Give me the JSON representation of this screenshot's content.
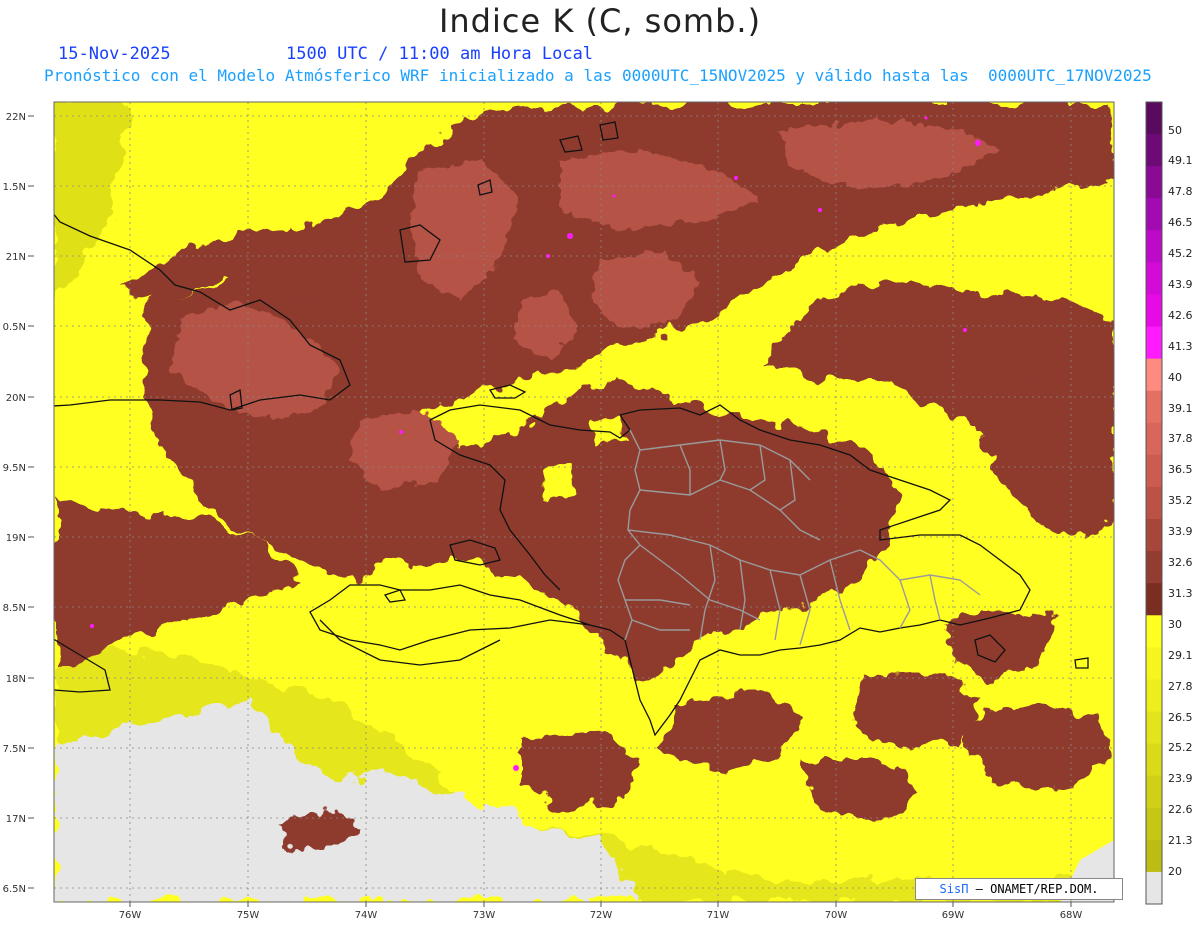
{
  "title": "Indice K (C, somb.)",
  "date_text": "15-Nov-2025",
  "time_text": "1500 UTC / 11:00 am Hora Local",
  "forecast_text": "Pronóstico con el Modelo Atmósferico WRF inicializado a las 0000UTC_15NOV2025 y válido hasta las  0000UTC_17NOV2025",
  "credit": {
    "logo_text": "SisΠ",
    "text": "– ONAMET/REP.DOM."
  },
  "lat_labels": [
    "22N",
    "1.5N",
    "21N",
    "0.5N",
    "20N",
    "9.5N",
    "19N",
    "8.5N",
    "18N",
    "7.5N",
    "17N",
    "6.5N"
  ],
  "lon_labels": [
    "76W",
    "75W",
    "74W",
    "73W",
    "72W",
    "71W",
    "70W",
    "69W",
    "68W"
  ],
  "colorbar": {
    "labels": [
      "50",
      "49.1",
      "47.8",
      "46.5",
      "45.2",
      "43.9",
      "42.6",
      "41.3",
      "40",
      "39.1",
      "37.8",
      "36.5",
      "35.2",
      "33.9",
      "32.6",
      "31.3",
      "30",
      "29.1",
      "27.8",
      "26.5",
      "25.2",
      "23.9",
      "22.6",
      "21.3",
      "20"
    ],
    "colors": [
      "#5a0a5e",
      "#6e0a78",
      "#8a0a96",
      "#a20ab2",
      "#bc0ac8",
      "#d40ad8",
      "#e80ae6",
      "#ff1aff",
      "#ff8a80",
      "#e47064",
      "#d8665a",
      "#cc5c50",
      "#bc5246",
      "#a8463c",
      "#923c32",
      "#7a2e22",
      "#ffff20",
      "#f6f61e",
      "#eeee1c",
      "#e4e41a",
      "#dada18",
      "#d0d016",
      "#c6c614",
      "#bcbc12",
      "#e6e6e6"
    ]
  },
  "field_colors": {
    "dark_brown": "#8b3a2c",
    "mid_brown": "#a8463c",
    "light": "#c8645a",
    "yellow": "#ffff22",
    "olive": "#d6d614",
    "no_data": "#e6e6e6",
    "magenta": "#ff1aff"
  }
}
